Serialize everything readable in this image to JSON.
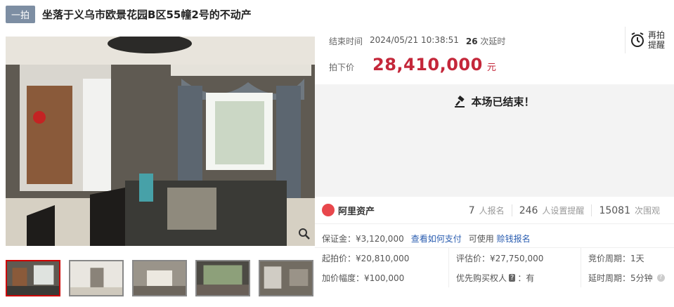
{
  "header": {
    "badge": "一拍",
    "title": "坐落于义乌市欧景花园B区55幢2号的不动产"
  },
  "auction": {
    "end_label": "结束时间",
    "end_time": "2024/05/21 10:38:51",
    "delay_count": "26",
    "delay_label": "次延时",
    "price_label": "拍下价",
    "price": "28,410,000",
    "price_unit": "元",
    "remind_line1": "再拍",
    "remind_line2": "提醒",
    "ended_text": "本场已结束！"
  },
  "stats": {
    "brand": "阿里资产",
    "signups_num": "7",
    "signups_label": "人报名",
    "reminders_num": "246",
    "reminders_label": "人设置提醒",
    "views_num": "15081",
    "views_label": "次围观"
  },
  "deposit": {
    "text": "保证金：¥3,120,000",
    "pay_link": "查看如何支付",
    "available": "可使用",
    "loan_link": "赊钱报名"
  },
  "details": {
    "start_price": "起拍价：¥20,810,000",
    "appraisal": "评估价：¥27,750,000",
    "bid_cycle": "竞价周期：1天",
    "increment": "加价幅度：¥100,000",
    "priority_label": "优先购买权人",
    "priority_tag": "?",
    "priority_value": "：有",
    "delay_cycle": "延时周期：5分钟"
  },
  "colors": {
    "price": "#c4273a",
    "badge": "#7d8ea3",
    "link": "#2a5db0",
    "active_thumb_border": "#cc0000"
  }
}
